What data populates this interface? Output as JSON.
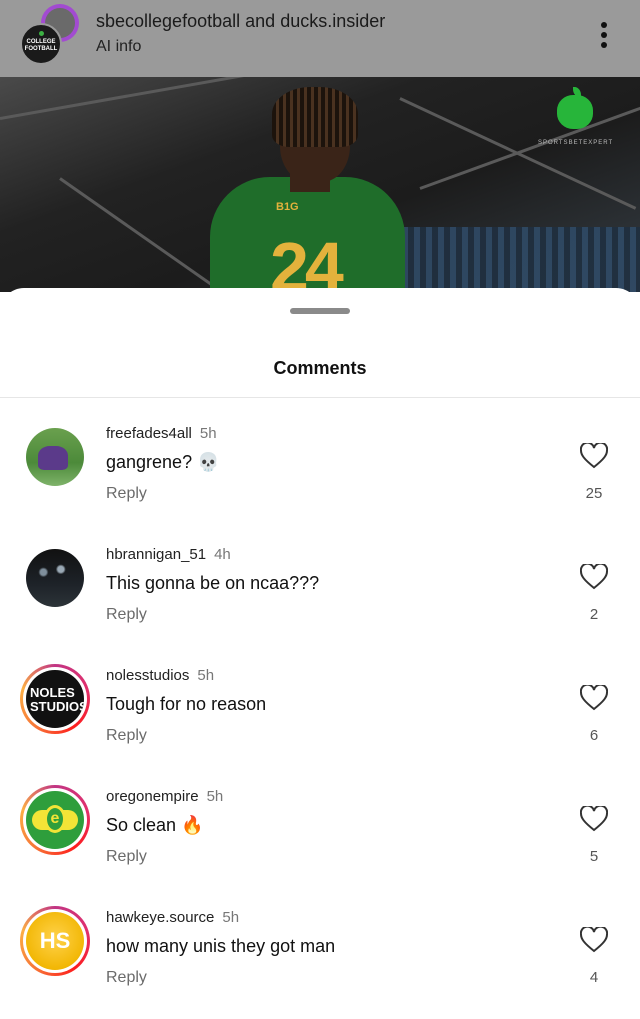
{
  "header": {
    "user_a": "sbecollegefootball",
    "joiner": "and",
    "user_b": "ducks.insider",
    "subtitle": "AI info",
    "front_avatar_text": "COLLEGE FOOTBALL"
  },
  "photo": {
    "watermark": "SPORTSBETEXPERT",
    "jersey_number": "24",
    "jersey_logo": "B1G"
  },
  "sheet": {
    "title": "Comments"
  },
  "comments": [
    {
      "user": "freefades4all",
      "time": "5h",
      "text": "gangrene? 💀",
      "reply": "Reply",
      "likes": "25",
      "avatar": "field-photo",
      "ring": false
    },
    {
      "user": "hbrannigan_51",
      "time": "4h",
      "text": "This gonna be on ncaa???",
      "reply": "Reply",
      "likes": "2",
      "avatar": "night-photo",
      "ring": false
    },
    {
      "user": "nolesstudios",
      "time": "5h",
      "text": "Tough for no reason",
      "reply": "Reply",
      "likes": "6",
      "avatar": "noles-logo",
      "ring": true,
      "avatar_text_1": "NOLES",
      "avatar_text_2": "STUDIOS"
    },
    {
      "user": "oregonempire",
      "time": "5h",
      "text": "So clean 🔥",
      "reply": "Reply",
      "likes": "5",
      "avatar": "oregon-logo",
      "ring": true
    },
    {
      "user": "hawkeye.source",
      "time": "5h",
      "text": "how many unis they got man",
      "reply": "Reply",
      "likes": "4",
      "avatar": "hawkeye-logo",
      "ring": true,
      "avatar_text_1": "HS"
    }
  ],
  "icons": {
    "menu": "kebab-vertical-icon",
    "like": "heart-outline-icon"
  },
  "colors": {
    "header_bg": "#9a9a9a",
    "story_ring": "#e1306c",
    "reply_text": "#6b6b6b"
  }
}
